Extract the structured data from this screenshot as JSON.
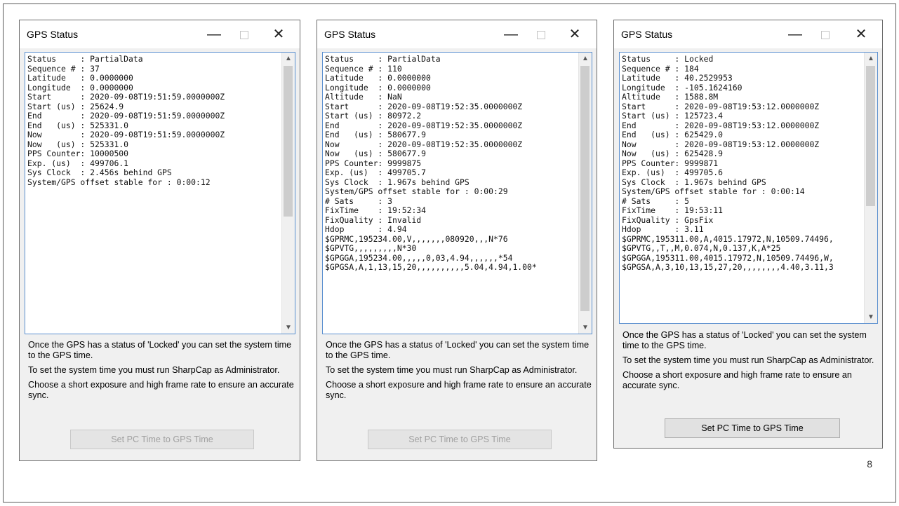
{
  "page_number": "8",
  "windows": [
    {
      "title": "GPS Status",
      "minimize": "—",
      "close": "✕",
      "lines": [
        "Status     : PartialData",
        "Sequence # : 37",
        "Latitude   : 0.0000000",
        "Longitude  : 0.0000000",
        "Start      : 2020-09-08T19:51:59.0000000Z",
        "Start (us) : 25624.9",
        "End        : 2020-09-08T19:51:59.0000000Z",
        "End   (us) : 525331.0",
        "Now        : 2020-09-08T19:51:59.0000000Z",
        "Now   (us) : 525331.0",
        "PPS Counter: 10000500",
        "Exp. (us)  : 499706.1",
        "Sys Clock  : 2.456s behind GPS",
        "System/GPS offset stable for : 0:00:12"
      ],
      "notes": [
        "Once the GPS has a status of 'Locked' you can set the system time to the GPS time.",
        "To set the system time you must run SharpCap as Administrator.",
        "Choose a short exposure and high frame rate to ensure an accurate sync."
      ],
      "button": "Set PC Time to GPS Time",
      "button_enabled": false
    },
    {
      "title": "GPS Status",
      "minimize": "—",
      "close": "✕",
      "lines": [
        "Status     : PartialData",
        "Sequence # : 110",
        "Latitude   : 0.0000000",
        "Longitude  : 0.0000000",
        "Altitude   : NaN",
        "Start      : 2020-09-08T19:52:35.0000000Z",
        "Start (us) : 80972.2",
        "End        : 2020-09-08T19:52:35.0000000Z",
        "End   (us) : 580677.9",
        "Now        : 2020-09-08T19:52:35.0000000Z",
        "Now   (us) : 580677.9",
        "PPS Counter: 9999875",
        "Exp. (us)  : 499705.7",
        "Sys Clock  : 1.967s behind GPS",
        "System/GPS offset stable for : 0:00:29",
        "# Sats     : 3",
        "FixTime    : 19:52:34",
        "FixQuality : Invalid",
        "Hdop       : 4.94",
        "$GPRMC,195234.00,V,,,,,,,080920,,,N*76",
        "$GPVTG,,,,,,,,,N*30",
        "$GPGGA,195234.00,,,,,0,03,4.94,,,,,,*54",
        "$GPGSA,A,1,13,15,20,,,,,,,,,,5.04,4.94,1.00*"
      ],
      "notes": [
        "Once the GPS has a status of 'Locked' you can set the system time to the GPS time.",
        "To set the system time you must run SharpCap as Administrator.",
        "Choose a short exposure and high frame rate to ensure an accurate sync."
      ],
      "button": "Set PC Time to GPS Time",
      "button_enabled": false
    },
    {
      "title": "GPS Status",
      "minimize": "—",
      "close": "✕",
      "lines": [
        "Status     : Locked",
        "Sequence # : 184",
        "Latitude   : 40.2529953",
        "Longitude  : -105.1624160",
        "Altitude   : 1588.8M",
        "Start      : 2020-09-08T19:53:12.0000000Z",
        "Start (us) : 125723.4",
        "End        : 2020-09-08T19:53:12.0000000Z",
        "End   (us) : 625429.0",
        "Now        : 2020-09-08T19:53:12.0000000Z",
        "Now   (us) : 625428.9",
        "PPS Counter: 9999871",
        "Exp. (us)  : 499705.6",
        "Sys Clock  : 1.967s behind GPS",
        "System/GPS offset stable for : 0:00:14",
        "# Sats     : 5",
        "FixTime    : 19:53:11",
        "FixQuality : GpsFix",
        "Hdop       : 3.11",
        "$GPRMC,195311.00,A,4015.17972,N,10509.74496,",
        "$GPVTG,,T,,M,0.074,N,0.137,K,A*25",
        "$GPGGA,195311.00,4015.17972,N,10509.74496,W,",
        "$GPGSA,A,3,10,13,15,27,20,,,,,,,,4.40,3.11,3"
      ],
      "notes": [
        "Once the GPS has a status of 'Locked' you can set the system time to the GPS time.",
        "To set the system time you must run SharpCap as Administrator.",
        "Choose a short exposure and high frame rate to ensure an accurate sync."
      ],
      "button": "Set PC Time to GPS Time",
      "button_enabled": true
    }
  ]
}
